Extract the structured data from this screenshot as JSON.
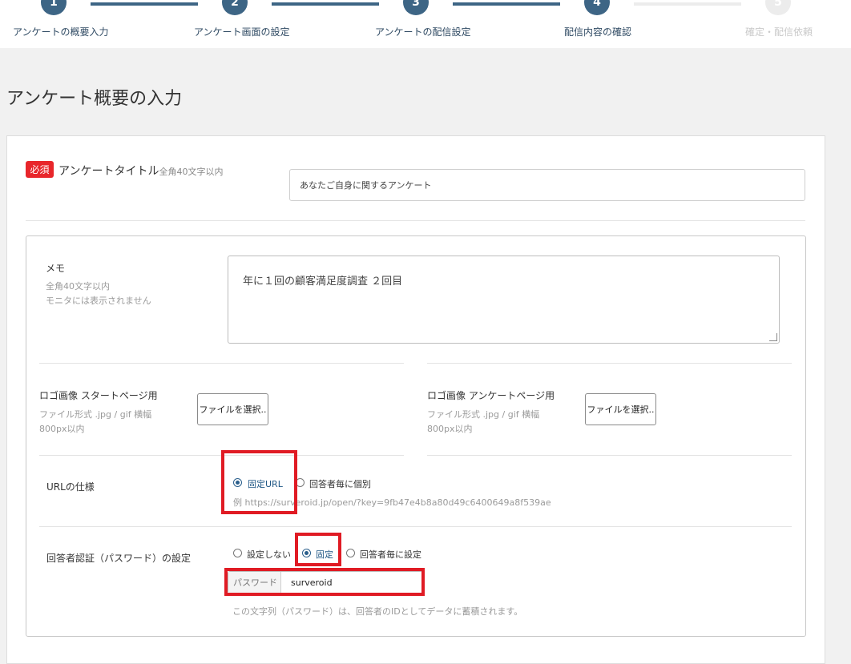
{
  "stepper": {
    "steps": [
      {
        "number": "1",
        "label": "アンケートの概要入力",
        "state": "done"
      },
      {
        "number": "2",
        "label": "アンケート画面の設定",
        "state": "done"
      },
      {
        "number": "3",
        "label": "アンケートの配信設定",
        "state": "done"
      },
      {
        "number": "4",
        "label": "配信内容の確認",
        "state": "current"
      },
      {
        "number": "5",
        "label": "確定・配信依頼",
        "state": "future"
      }
    ],
    "colors": {
      "active": "#3d6585",
      "inactive": "#ececec"
    }
  },
  "page": {
    "title": "アンケート概要の入力"
  },
  "form": {
    "required_badge": "必須",
    "title_label": "アンケートタイトル",
    "title_hint": "全角40文字以内",
    "title_value": "あなたご自身に関するアンケート",
    "memo": {
      "label": "メモ",
      "hint1": "全角40文字以内",
      "hint2": "モニタには表示されません",
      "value": "年に１回の顧客満足度調査 ２回目"
    },
    "logo_start": {
      "label": "ロゴ画像 スタートページ用",
      "hint1": "ファイル形式 .jpg / gif 横幅",
      "hint2": "800px以内",
      "button": "ファイルを選択.."
    },
    "logo_survey": {
      "label": "ロゴ画像 アンケートページ用",
      "hint1": "ファイル形式 .jpg / gif 横幅",
      "hint2": "800px以内",
      "button": "ファイルを選択.."
    },
    "url_spec": {
      "label": "URLの仕様",
      "options": [
        "固定URL",
        "回答者毎に個別"
      ],
      "selected": "固定URL",
      "example": "例 https://surveroid.jp/open/?key=9fb47e4b8a80d49c6400649a8f539ae"
    },
    "auth": {
      "label": "回答者認証（パスワード）の設定",
      "options": [
        "設定しない",
        "固定",
        "回答者毎に設定"
      ],
      "selected": "固定",
      "password_prefix": "パスワード",
      "password_value": "surveroid",
      "note": "この文字列（パスワード）は、回答者のIDとしてデータに蓄積されます。"
    }
  },
  "annotation_color": "#e01b24"
}
